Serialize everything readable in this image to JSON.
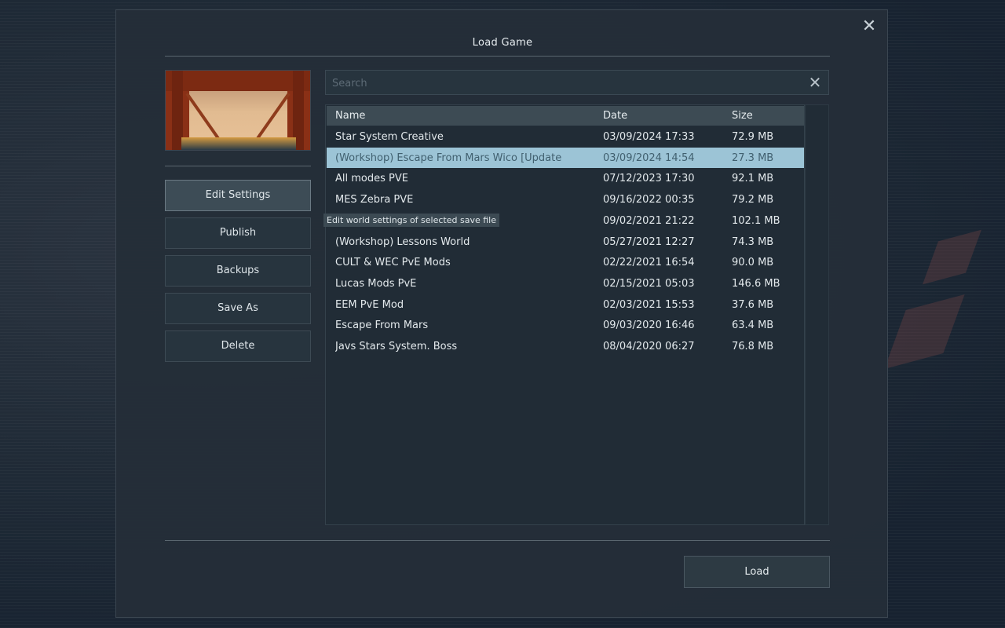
{
  "dialog": {
    "title": "Load Game",
    "close_icon": "close-icon"
  },
  "preview": {
    "image": "world-thumbnail"
  },
  "actions": [
    {
      "label": "Edit Settings",
      "active": true
    },
    {
      "label": "Publish",
      "active": false
    },
    {
      "label": "Backups",
      "active": false
    },
    {
      "label": "Save As",
      "active": false
    },
    {
      "label": "Delete",
      "active": false
    }
  ],
  "search": {
    "placeholder": "Search",
    "value": "",
    "clear_icon": "close-icon"
  },
  "table": {
    "columns": [
      "Name",
      "Date",
      "Size"
    ],
    "rows": [
      {
        "name": "Star System Creative",
        "date": "03/09/2024 17:33",
        "size": "72.9 MB",
        "selected": false
      },
      {
        "name": "(Workshop) Escape From Mars Wico [Update",
        "date": "03/09/2024 14:54",
        "size": "27.3 MB",
        "selected": true
      },
      {
        "name": "All modes PVE",
        "date": "07/12/2023 17:30",
        "size": "92.1 MB",
        "selected": false
      },
      {
        "name": "MES Zebra PVE",
        "date": "09/16/2022 00:35",
        "size": "79.2 MB",
        "selected": false
      },
      {
        "name": "",
        "date": "09/02/2021 21:22",
        "size": "102.1 MB",
        "selected": false
      },
      {
        "name": "(Workshop) Lessons World",
        "date": "05/27/2021 12:27",
        "size": "74.3 MB",
        "selected": false
      },
      {
        "name": "CULT & WEC PvE Mods",
        "date": "02/22/2021 16:54",
        "size": "90.0 MB",
        "selected": false
      },
      {
        "name": "Lucas Mods PvE",
        "date": "02/15/2021 05:03",
        "size": "146.6 MB",
        "selected": false
      },
      {
        "name": "EEM PvE Mod",
        "date": "02/03/2021 15:53",
        "size": "37.6 MB",
        "selected": false
      },
      {
        "name": "Escape From Mars",
        "date": "09/03/2020 16:46",
        "size": "63.4 MB",
        "selected": false
      },
      {
        "name": "Javs Stars System. Boss",
        "date": "08/04/2020 06:27",
        "size": "76.8 MB",
        "selected": false
      }
    ]
  },
  "tooltip": {
    "text": "Edit world settings of selected save file"
  },
  "footer": {
    "load_label": "Load"
  },
  "colors": {
    "selected_row": "#9cc4d6",
    "header_row": "#3d4b54",
    "panel": "#242e38"
  }
}
